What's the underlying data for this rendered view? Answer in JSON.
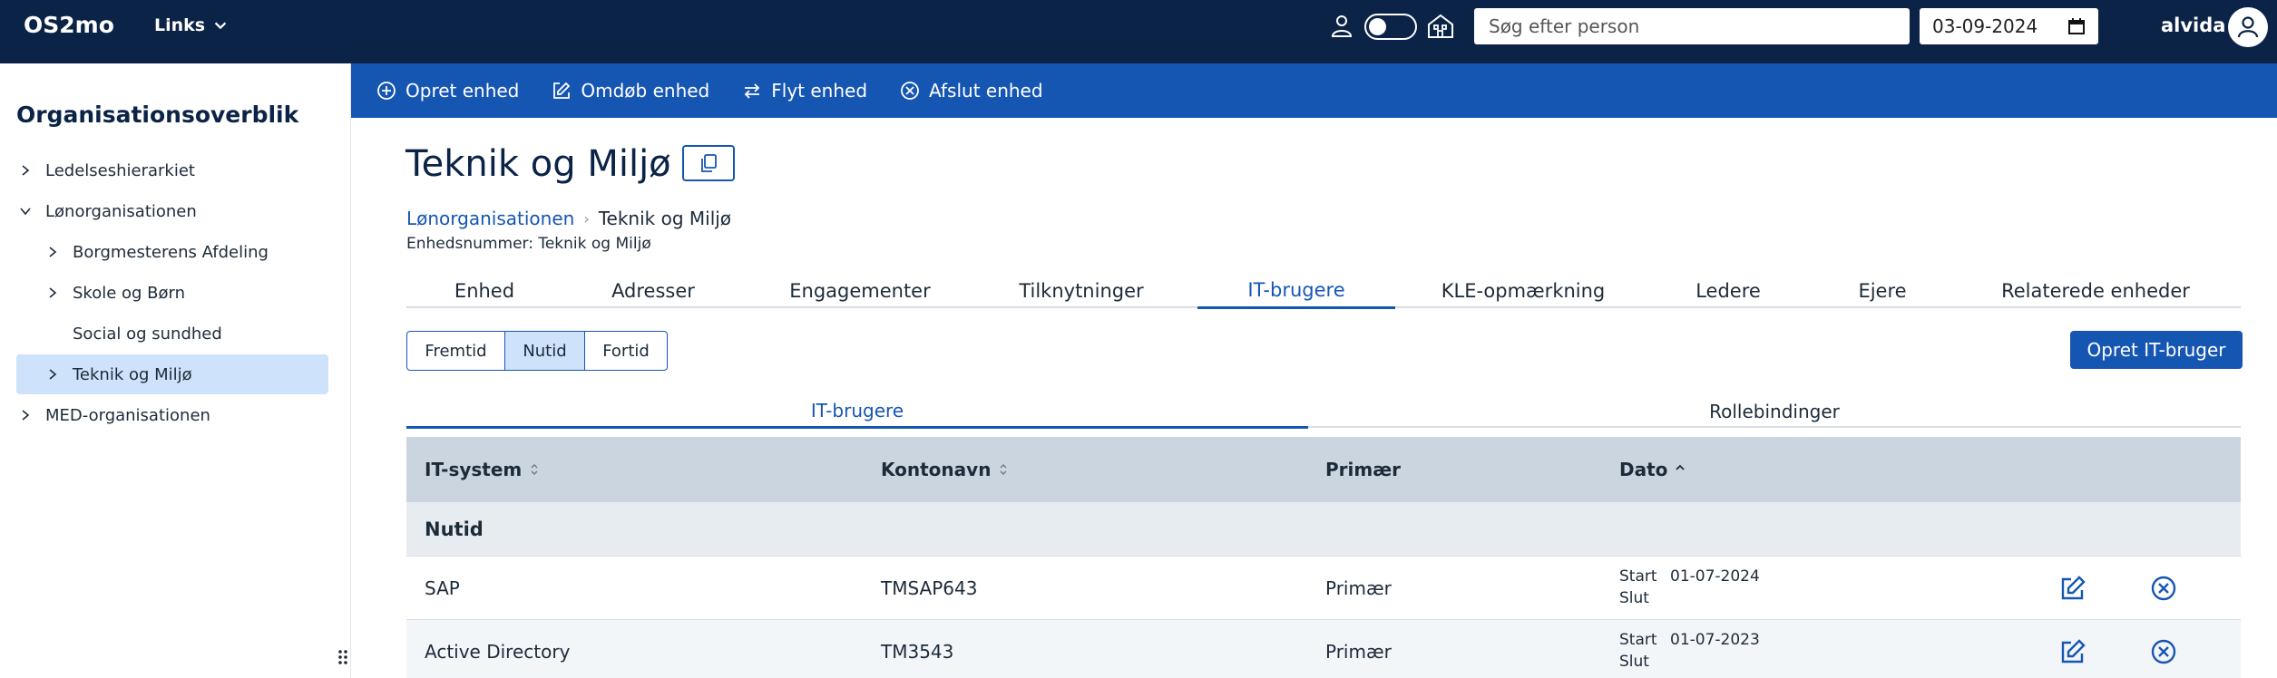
{
  "topbar": {
    "brand": "OS2mo",
    "links_label": "Links",
    "search_placeholder": "Søg efter person",
    "date": "03-09-2024",
    "user": "alvida"
  },
  "sidebar": {
    "title": "Organisationsoverblik",
    "items": [
      {
        "label": "Ledelseshierarkiet",
        "expander": "chevron-right"
      },
      {
        "label": "Lønorganisationen",
        "expander": "chevron-down"
      },
      {
        "label": "Borgmesterens Afdeling",
        "expander": "chevron-right"
      },
      {
        "label": "Skole og Børn",
        "expander": "chevron-right"
      },
      {
        "label": "Social og sundhed",
        "expander": "none"
      },
      {
        "label": "Teknik og Miljø",
        "expander": "chevron-right",
        "selected": true
      },
      {
        "label": "MED-organisationen",
        "expander": "chevron-right"
      }
    ]
  },
  "actions": {
    "create": "Opret enhed",
    "rename": "Omdøb enhed",
    "move": "Flyt enhed",
    "terminate": "Afslut enhed"
  },
  "page": {
    "title": "Teknik og Miljø",
    "breadcrumb": {
      "parent": "Lønorganisationen",
      "current": "Teknik og Miljø"
    },
    "unit_number": "Enhedsnummer: Teknik og Miljø"
  },
  "tabs": {
    "items": [
      "Enhed",
      "Adresser",
      "Engagementer",
      "Tilknytninger",
      "IT-brugere",
      "KLE-opmærkning",
      "Ledere",
      "Ejere",
      "Relaterede enheder"
    ],
    "active": "IT-brugere"
  },
  "time_filter": {
    "options": [
      "Fremtid",
      "Nutid",
      "Fortid"
    ],
    "selected": "Nutid"
  },
  "create_it_user_button": "Opret IT-bruger",
  "subtabs": {
    "items": [
      "IT-brugere",
      "Rollebindinger"
    ],
    "active": "IT-brugere"
  },
  "table": {
    "headers": [
      "IT-system",
      "Kontonavn",
      "Primær",
      "Dato"
    ],
    "group_label": "Nutid",
    "rows": [
      {
        "it_system": "SAP",
        "account": "TMSAP643",
        "primary": "Primær",
        "start_label": "Start",
        "start": "01-07-2024",
        "end_label": "Slut",
        "end": ""
      },
      {
        "it_system": "Active Directory",
        "account": "TM3543",
        "primary": "Primær",
        "start_label": "Start",
        "start": "01-07-2023",
        "end_label": "Slut",
        "end": ""
      }
    ]
  },
  "colors": {
    "topbar": "#0b2346",
    "accent": "#1656b3",
    "selected_bg": "#cfe2fb",
    "table_header": "#cbd5df"
  }
}
